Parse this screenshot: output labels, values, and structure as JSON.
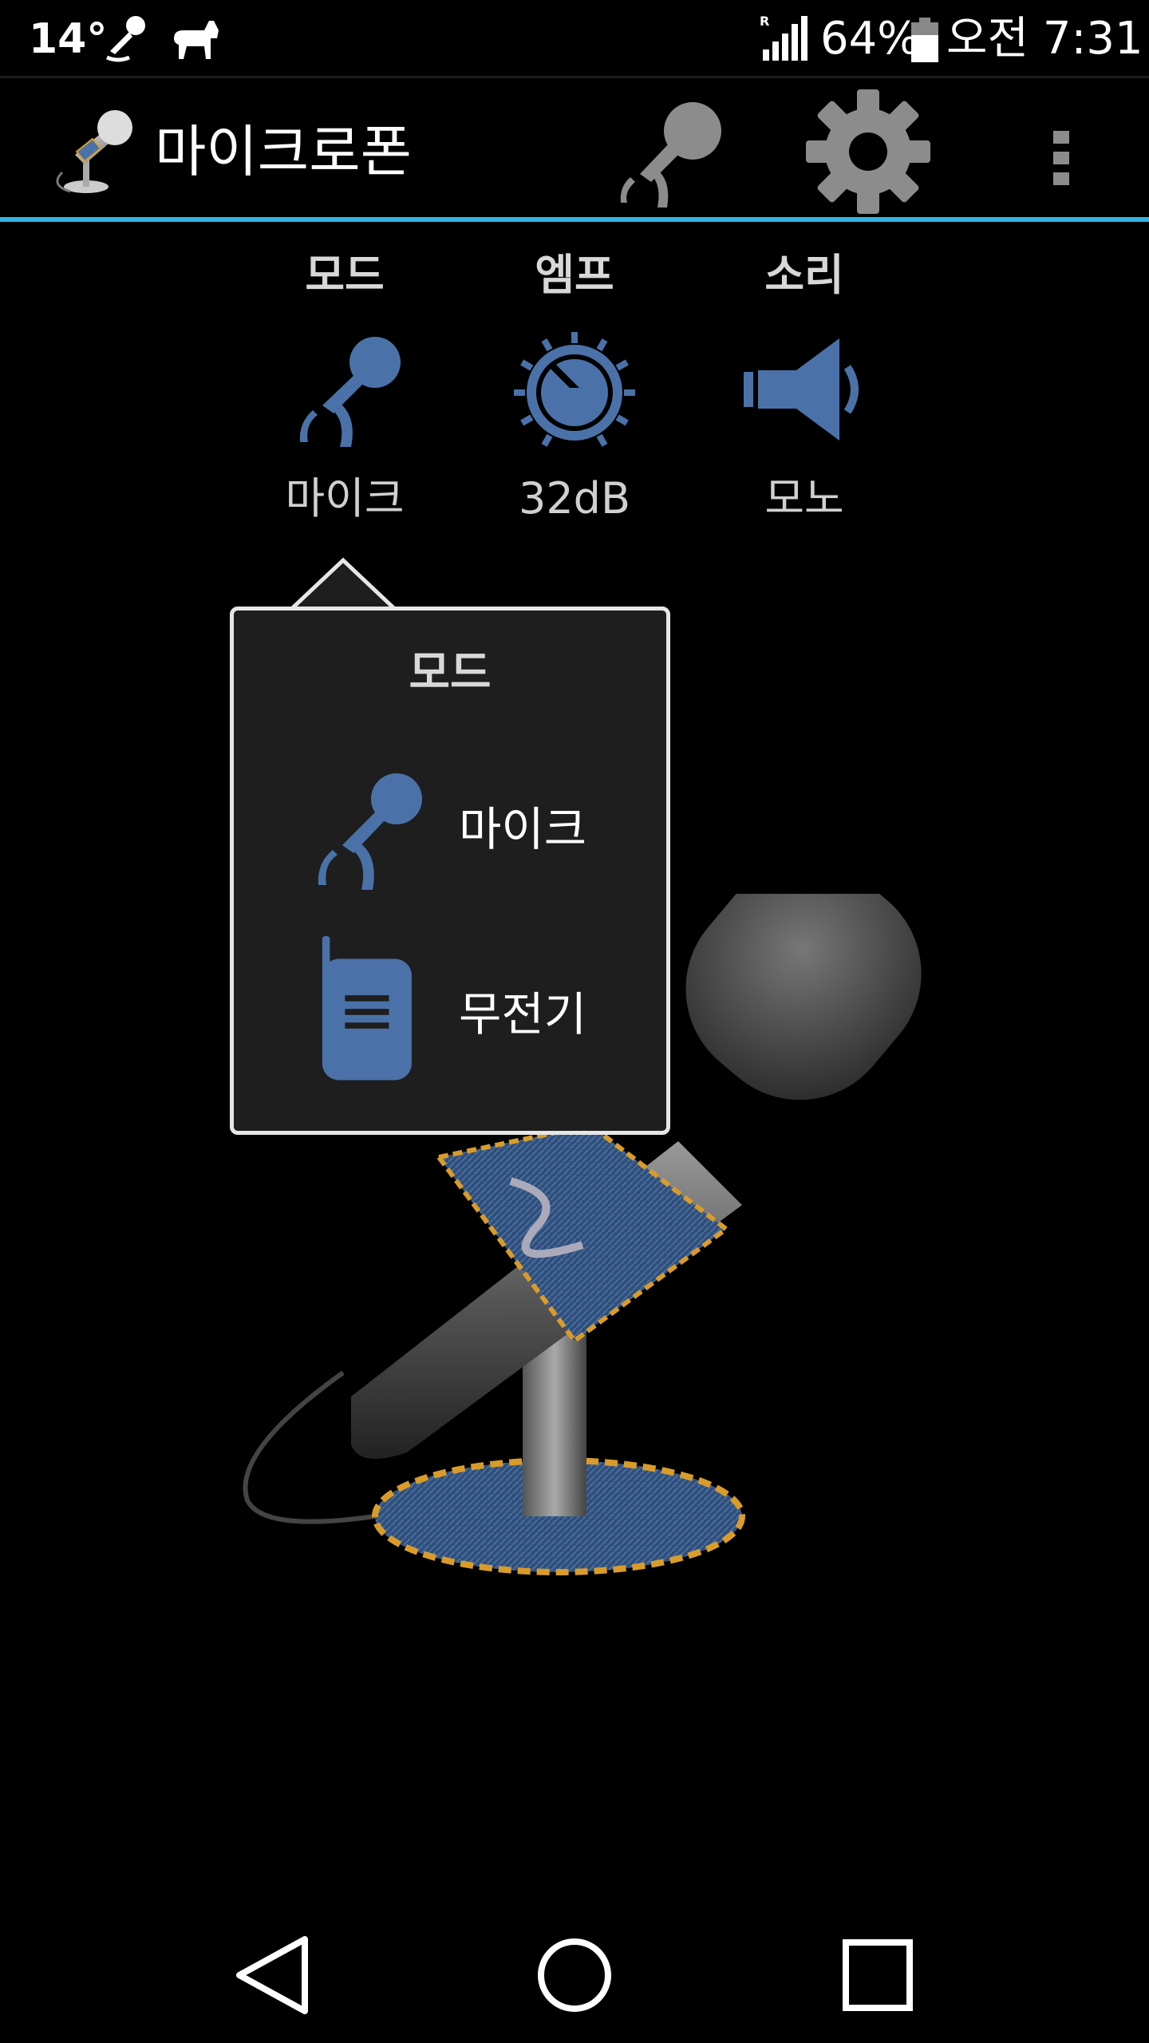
{
  "status_bar": {
    "temperature": "14°",
    "battery_percent": "64%",
    "time": "오전 7:31",
    "icons": [
      "mic-notification-icon",
      "dog-notification-icon",
      "signal-icon",
      "battery-icon"
    ]
  },
  "action_bar": {
    "title": "마이크로폰",
    "icons": [
      "app-mic-icon",
      "microphone-icon",
      "gear-icon",
      "overflow-menu-icon"
    ]
  },
  "controls": [
    {
      "title": "모드",
      "value": "마이크",
      "icon": "microphone-icon"
    },
    {
      "title": "엠프",
      "value": "32dB",
      "icon": "knob-icon"
    },
    {
      "title": "소리",
      "value": "모노",
      "icon": "speaker-icon"
    }
  ],
  "popup": {
    "title": "모드",
    "items": [
      {
        "label": "마이크",
        "icon": "microphone-icon"
      },
      {
        "label": "무전기",
        "icon": "walkie-talkie-icon"
      }
    ]
  },
  "nav_bar": {
    "icons": [
      "back-icon",
      "home-icon",
      "recent-apps-icon"
    ]
  },
  "colors": {
    "accent": "#33b5e5",
    "icon_blue": "#4a72a8",
    "background": "#000000",
    "popup_bg": "#1e1e1f"
  }
}
